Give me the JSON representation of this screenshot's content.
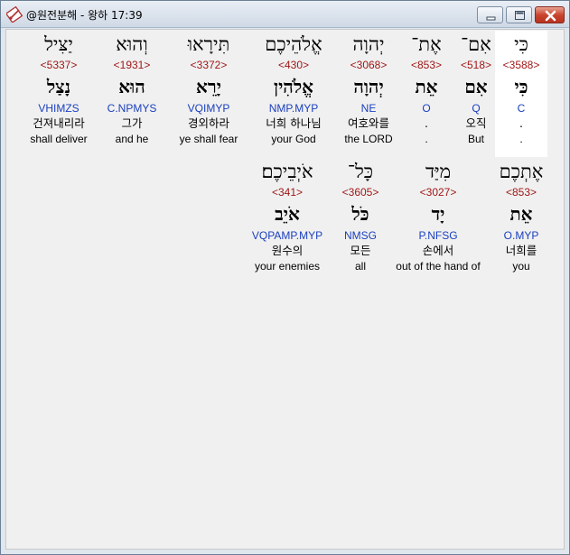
{
  "window": {
    "title": "@원전분해 - 왕하 17:39",
    "icon": "bible-analysis-app-icon",
    "minimize_icon": "minimize-icon",
    "maximize_icon": "maximize-icon",
    "close_icon": "close-icon"
  },
  "row1": [
    {
      "heb": "כִּי",
      "strong": "<3588>",
      "lemma": "כִּי",
      "morph": "C",
      "kor": ".",
      "eng": ".",
      "selected": true
    },
    {
      "heb": "אִם־",
      "strong": "<518>",
      "lemma": "אִם",
      "morph": "Q",
      "kor": "오직",
      "eng": "But",
      "selected": false
    },
    {
      "heb": "אֶת־",
      "strong": "<853>",
      "lemma": "אֵת",
      "morph": "O",
      "kor": ".",
      "eng": ".",
      "selected": false
    },
    {
      "heb": "יְהוָה",
      "strong": "<3068>",
      "lemma": "יְהוָה",
      "morph": "NE",
      "kor": "여호와를",
      "eng": "the LORD",
      "selected": false
    },
    {
      "heb": "אֱלֹהֵיכֶם",
      "strong": "<430>",
      "lemma": "אֱלֹהִין",
      "morph": "NMP.MYP",
      "kor": "너희 하나님",
      "eng": "your God",
      "selected": false
    },
    {
      "heb": "תִּירָאוּ",
      "strong": "<3372>",
      "lemma": "יָרֵא",
      "morph": "VQIMYP",
      "kor": "경외하라",
      "eng": "ye shall fear",
      "selected": false
    },
    {
      "heb": "וְהוּא",
      "strong": "<1931>",
      "lemma": "הוּא",
      "morph": "C.NPMYS",
      "kor": "그가",
      "eng": "and he",
      "selected": false
    },
    {
      "heb": "יַצִּיל",
      "strong": "<5337>",
      "lemma": "נָצַל",
      "morph": "VHIMZS",
      "kor": "건져내리라",
      "eng": "shall deliver",
      "selected": false
    }
  ],
  "row2": [
    {
      "heb": "אֶתְכֶם",
      "strong": "<853>",
      "lemma": "אֵת",
      "morph": "O.MYP",
      "kor": "너희를",
      "eng": "you"
    },
    {
      "heb": "מִיַּד",
      "strong": "<3027>",
      "lemma": "יָד",
      "morph": "P.NFSG",
      "kor": "손에서",
      "eng": "out of the hand of"
    },
    {
      "heb": "כָּל־",
      "strong": "<3605>",
      "lemma": "כֹּל",
      "morph": "NMSG",
      "kor": "모든",
      "eng": "all"
    },
    {
      "heb": "אֹיְבֵיכֶם׃",
      "strong": "<341>",
      "lemma": "אֹיֵב",
      "morph": "VQPAMP.MYP",
      "kor": "원수의",
      "eng": "your enemies"
    }
  ],
  "colors": {
    "strong": "#a01818",
    "morph": "#1a3fbf",
    "selected_bg": "#ffffff"
  }
}
